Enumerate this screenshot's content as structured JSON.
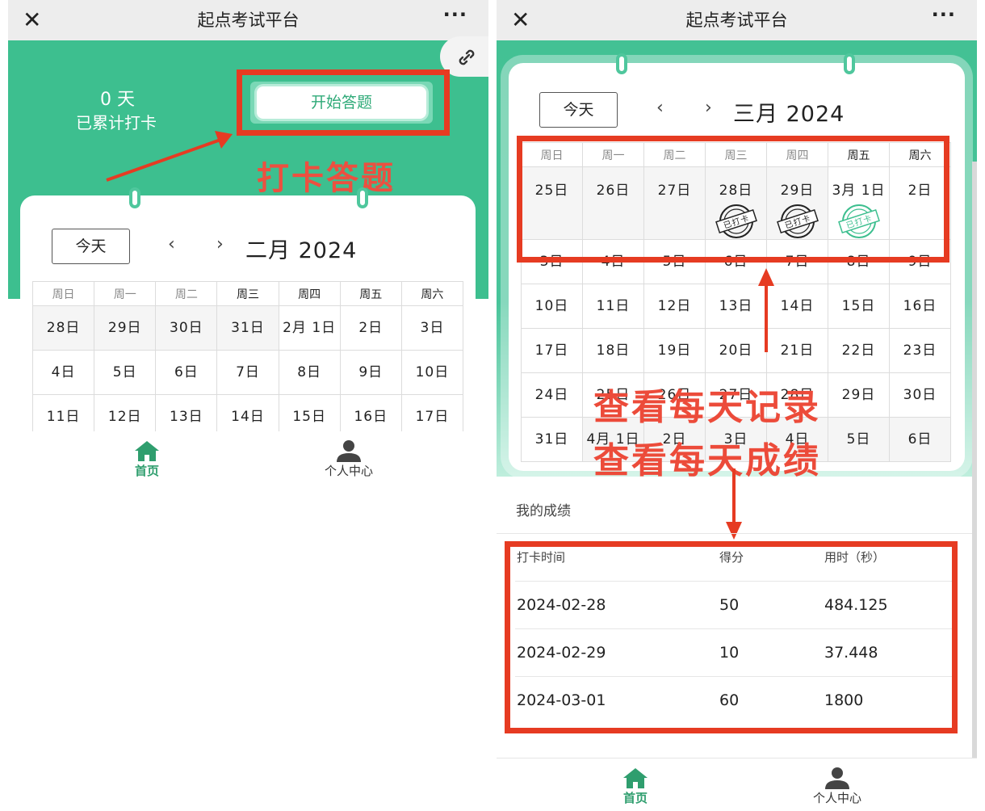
{
  "app": {
    "title": "起点考试平台"
  },
  "left": {
    "streak_num": "0  天",
    "streak_label": "已累计打卡",
    "start_button": "开始答题",
    "annotation": "打卡答题",
    "calendar": {
      "today_button": "今天",
      "prev": "‹",
      "next": "›",
      "month": "二月 2024",
      "weekdays": [
        "周日",
        "周一",
        "周二",
        "周三",
        "周四",
        "周五",
        "周六"
      ],
      "rows": [
        [
          "28日",
          "29日",
          "30日",
          "31日",
          "2月 1日",
          "2日",
          "3日"
        ],
        [
          "4日",
          "5日",
          "6日",
          "7日",
          "8日",
          "9日",
          "10日"
        ],
        [
          "11日",
          "12日",
          "13日",
          "14日",
          "15日",
          "16日",
          "17日"
        ]
      ]
    },
    "tabbar": {
      "home": "首页",
      "profile": "个人中心"
    }
  },
  "right": {
    "calendar": {
      "today_button": "今天",
      "prev": "‹",
      "next": "›",
      "month": "三月 2024",
      "weekdays": [
        "周日",
        "周一",
        "周二",
        "周三",
        "周四",
        "周五",
        "周六"
      ],
      "rows": [
        [
          "25日",
          "26日",
          "27日",
          "28日",
          "29日",
          "3月 1日",
          "2日"
        ],
        [
          "3日",
          "4日",
          "5日",
          "6日",
          "7日",
          "8日",
          "9日"
        ],
        [
          "10日",
          "11日",
          "12日",
          "13日",
          "14日",
          "15日",
          "16日"
        ],
        [
          "17日",
          "18日",
          "19日",
          "20日",
          "21日",
          "22日",
          "23日"
        ],
        [
          "24日",
          "25日",
          "26日",
          "27日",
          "28日",
          "29日",
          "30日"
        ],
        [
          "31日",
          "4月 1日",
          "2日",
          "3日",
          "4日",
          "5日",
          "6日"
        ]
      ],
      "stamp_text": "已打卡"
    },
    "annotation_1": "查看每天记录",
    "annotation_2": "查看每天成绩",
    "scores": {
      "section_title": "我的成绩",
      "headers": [
        "打卡时间",
        "得分",
        "用时（秒）"
      ],
      "rows": [
        [
          "2024-02-28",
          "50",
          "484.125"
        ],
        [
          "2024-02-29",
          "10",
          "37.448"
        ],
        [
          "2024-03-01",
          "60",
          "1800"
        ]
      ]
    },
    "tabbar": {
      "home": "首页",
      "profile": "个人中心"
    }
  },
  "colors": {
    "brand_green": "#3dbf8f",
    "annotation_red": "#e63b22"
  }
}
